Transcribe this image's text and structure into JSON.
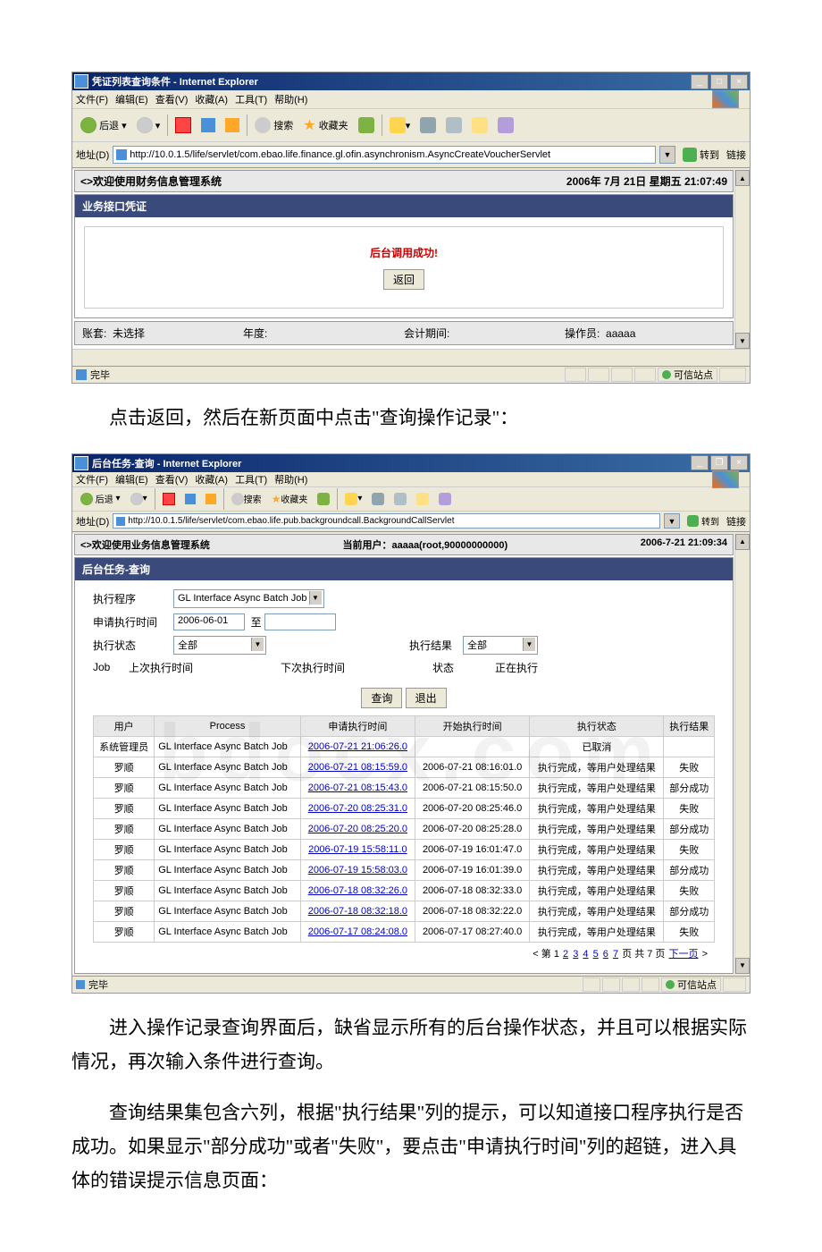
{
  "shot1": {
    "window_title": "凭证列表查询条件 - Internet Explorer",
    "menus": [
      "文件(F)",
      "编辑(E)",
      "查看(V)",
      "收藏(A)",
      "工具(T)",
      "帮助(H)"
    ],
    "toolbar": {
      "back": "后退",
      "search": "搜索",
      "fav": "收藏夹"
    },
    "addr_label": "地址(D)",
    "url": "http://10.0.1.5/life/servlet/com.ebao.life.finance.gl.ofin.asynchronism.AsyncCreateVoucherServlet",
    "go": "转到",
    "links": "链接",
    "sys_welcome": "<>欢迎使用财务信息管理系统",
    "sys_time": "2006年 7月 21日  星期五  21:07:49",
    "panel_title": "业务接口凭证",
    "success_msg": "后台调用成功!",
    "back_btn": "返回",
    "footer": {
      "acct_l": "账套:",
      "acct_v": "未选择",
      "year_l": "年度:",
      "period_l": "会计期间:",
      "oper_l": "操作员:",
      "oper_v": "aaaaa"
    },
    "status_done": "完毕",
    "status_trust": "可信站点"
  },
  "para1": "点击返回，然后在新页面中点击\"查询操作记录\"：",
  "shot2": {
    "window_title": "后台任务-查询 - Internet Explorer",
    "menus": [
      "文件(F)",
      "编辑(E)",
      "查看(V)",
      "收藏(A)",
      "工具(T)",
      "帮助(H)"
    ],
    "toolbar": {
      "back": "后退",
      "search": "搜索",
      "fav": "收藏夹"
    },
    "addr_label": "地址(D)",
    "url": "http://10.0.1.5/life/servlet/com.ebao.life.pub.backgroundcall.BackgroundCallServlet",
    "go": "转到",
    "links": "链接",
    "sys_welcome": "<>欢迎使用业务信息管理系统",
    "sys_user": "当前用户：aaaaa(root,90000000000)",
    "sys_time": "2006-7-21 21:09:34",
    "panel_title": "后台任务-查询",
    "form": {
      "proc_l": "执行程序",
      "proc_v": "GL Interface Async Batch Job",
      "apply_l": "申请执行时间",
      "apply_v": "2006-06-01",
      "to": "至",
      "state_l": "执行状态",
      "state_v": "全部",
      "result_l": "执行结果",
      "result_v": "全部",
      "job_l": "Job",
      "last_l": "上次执行时间",
      "next_l": "下次执行时间",
      "running_l": "状态",
      "running_v": "正在执行",
      "query_btn": "查询",
      "exit_btn": "退出"
    },
    "cols": [
      "用户",
      "Process",
      "申请执行时间",
      "开始执行时间",
      "执行状态",
      "执行结果"
    ],
    "rows": [
      {
        "user": "系统管理员",
        "proc": "GL Interface Async Batch Job",
        "apply": "2006-07-21 21:06:26.0",
        "start": "",
        "state": "已取消",
        "result": ""
      },
      {
        "user": "罗顺",
        "proc": "GL Interface Async Batch Job",
        "apply": "2006-07-21 08:15:59.0",
        "start": "2006-07-21 08:16:01.0",
        "state": "执行完成，等用户处理结果",
        "result": "失败"
      },
      {
        "user": "罗顺",
        "proc": "GL Interface Async Batch Job",
        "apply": "2006-07-21 08:15:43.0",
        "start": "2006-07-21 08:15:50.0",
        "state": "执行完成，等用户处理结果",
        "result": "部分成功"
      },
      {
        "user": "罗顺",
        "proc": "GL Interface Async Batch Job",
        "apply": "2006-07-20 08:25:31.0",
        "start": "2006-07-20 08:25:46.0",
        "state": "执行完成，等用户处理结果",
        "result": "失败"
      },
      {
        "user": "罗顺",
        "proc": "GL Interface Async Batch Job",
        "apply": "2006-07-20 08:25:20.0",
        "start": "2006-07-20 08:25:28.0",
        "state": "执行完成，等用户处理结果",
        "result": "部分成功"
      },
      {
        "user": "罗顺",
        "proc": "GL Interface Async Batch Job",
        "apply": "2006-07-19 15:58:11.0",
        "start": "2006-07-19 16:01:47.0",
        "state": "执行完成，等用户处理结果",
        "result": "失败"
      },
      {
        "user": "罗顺",
        "proc": "GL Interface Async Batch Job",
        "apply": "2006-07-19 15:58:03.0",
        "start": "2006-07-19 16:01:39.0",
        "state": "执行完成，等用户处理结果",
        "result": "部分成功"
      },
      {
        "user": "罗顺",
        "proc": "GL Interface Async Batch Job",
        "apply": "2006-07-18 08:32:26.0",
        "start": "2006-07-18 08:32:33.0",
        "state": "执行完成，等用户处理结果",
        "result": "失败"
      },
      {
        "user": "罗顺",
        "proc": "GL Interface Async Batch Job",
        "apply": "2006-07-18 08:32:18.0",
        "start": "2006-07-18 08:32:22.0",
        "state": "执行完成，等用户处理结果",
        "result": "部分成功"
      },
      {
        "user": "罗顺",
        "proc": "GL Interface Async Batch Job",
        "apply": "2006-07-17 08:24:08.0",
        "start": "2006-07-17 08:27:40.0",
        "state": "执行完成，等用户处理结果",
        "result": "失败"
      }
    ],
    "pager": {
      "prefix": "< 第",
      "nums": [
        "1",
        "2",
        "3",
        "4",
        "5",
        "6",
        "7"
      ],
      "mid": "页 共 7 页",
      "next": "下一页",
      "end": ">"
    },
    "status_done": "完毕",
    "status_trust": "可信站点"
  },
  "para2": "进入操作记录查询界面后，缺省显示所有的后台操作状态，并且可以根据实际情况，再次输入条件进行查询。",
  "para3": "查询结果集包含六列，根据\"执行结果\"列的提示，可以知道接口程序执行是否成功。如果显示\"部分成功\"或者\"失败\"，要点击\"申请执行时间\"列的超链，进入具体的错误提示信息页面："
}
